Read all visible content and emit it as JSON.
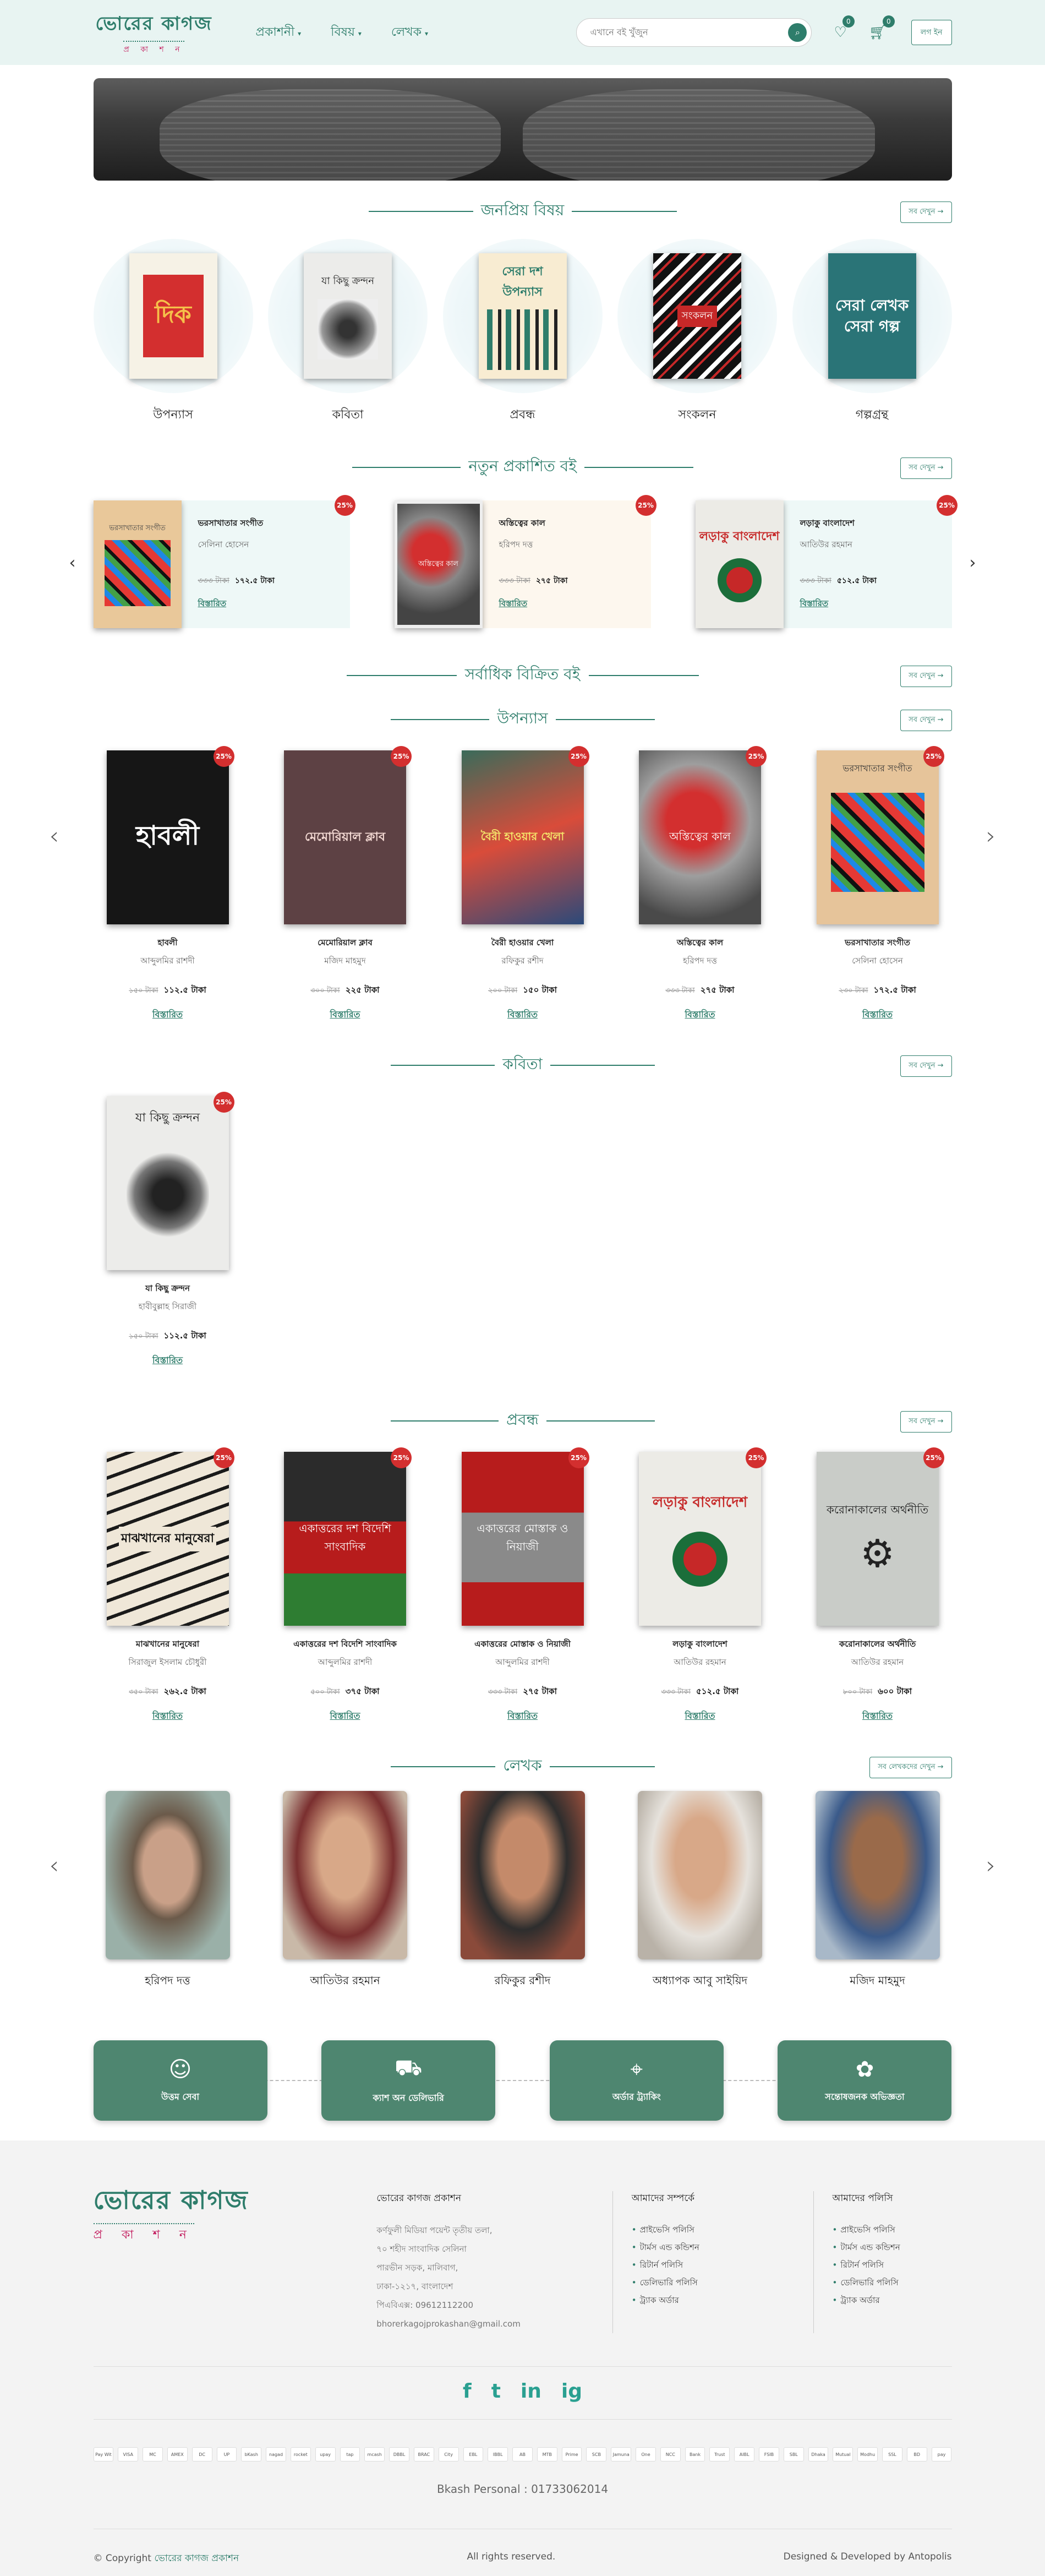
{
  "header": {
    "logo_top": "ভোরের কাগজ",
    "logo_bottom": "প্র কা শ ন",
    "nav": [
      "প্রকাশনী",
      "বিষয়",
      "লেখক"
    ],
    "search_placeholder": "এখানে বই খুঁজুন",
    "wishlist_count": "0",
    "cart_count": "0",
    "login_label": "লগ ইন"
  },
  "popular": {
    "title": "জনপ্রিয় বিষয়",
    "more": "সব দেখুন →",
    "items": [
      {
        "name": "উপন্যাস",
        "cover_text": "দিক"
      },
      {
        "name": "কবিতা",
        "cover_text": "যা কিছু ক্রন্দন"
      },
      {
        "name": "প্রবন্ধ",
        "cover_text": "সেরা দশ উপন্যাস"
      },
      {
        "name": "সংকলন",
        "cover_text": "সংকলন"
      },
      {
        "name": "গল্পগ্রন্থ",
        "cover_text": "সেরা লেখক সেরা গল্প"
      }
    ]
  },
  "new_releases": {
    "title": "নতুন প্রকাশিত বই",
    "more": "সব দেখুন →",
    "items": [
      {
        "title": "ভরসাখাতার সংগীত",
        "author": "সেলিনা হোসেন",
        "old": "৩৩৩ টাকা",
        "price": "১৭২.৫ টাকা",
        "discount": "25%",
        "cta": "বিস্তারিত"
      },
      {
        "title": "অস্তিত্বের কাল",
        "author": "হরিপদ দত্ত",
        "old": "৩৩৩ টাকা",
        "price": "২৭৫ টাকা",
        "discount": "25%",
        "cta": "বিস্তারিত"
      },
      {
        "title": "লড়াকু বাংলাদেশ",
        "author": "আতিউর রহমান",
        "old": "৩৩৩ টাকা",
        "price": "৫১২.৫ টাকা",
        "discount": "25%",
        "cta": "বিস্তারিত"
      }
    ]
  },
  "bestseller": {
    "title": "সর্বাধিক বিক্রিত বই",
    "more": "সব দেখুন →"
  },
  "novels": {
    "title": "উপন্যাস",
    "more": "সব দেখুন →",
    "items": [
      {
        "title": "হাবলী",
        "author": "আব্দুলমির রাশদী",
        "old": "১৫০ টাকা",
        "price": "১১২.৫ টাকা",
        "discount": "25%",
        "cta": "বিস্তারিত",
        "cover_text": "হাবলী"
      },
      {
        "title": "মেমোরিয়াল ক্লাব",
        "author": "মজিদ মাহমুদ",
        "old": "৩০০ টাকা",
        "price": "২২৫ টাকা",
        "discount": "25%",
        "cta": "বিস্তারিত",
        "cover_text": "মেমোরিয়াল ক্লাব"
      },
      {
        "title": "বৈরী হাওয়ার খেলা",
        "author": "রফিকুর রশীদ",
        "old": "২০০ টাকা",
        "price": "১৫০ টাকা",
        "discount": "25%",
        "cta": "বিস্তারিত",
        "cover_text": "বৈরী হাওয়ার খেলা"
      },
      {
        "title": "অস্তিত্বের কাল",
        "author": "হরিপদ দত্ত",
        "old": "৩৩৩ টাকা",
        "price": "২৭৫ টাকা",
        "discount": "25%",
        "cta": "বিস্তারিত",
        "cover_text": "অস্তিত্বের কাল"
      },
      {
        "title": "ভরসাখাতার সংগীত",
        "author": "সেলিনা হোসেন",
        "old": "২৩০ টাকা",
        "price": "১৭২.৫ টাকা",
        "discount": "25%",
        "cta": "বিস্তারিত",
        "cover_text": "ভরসাখাতার সংগীত"
      }
    ]
  },
  "poetry": {
    "title": "কবিতা",
    "more": "সব দেখুন →",
    "items": [
      {
        "title": "যা কিছু ক্রন্দন",
        "author": "হাবীবুল্লাহ সিরাজী",
        "old": "১৫০ টাকা",
        "price": "১১২.৫ টাকা",
        "discount": "25%",
        "cta": "বিস্তারিত",
        "cover_text": "যা কিছু ক্রন্দন"
      }
    ]
  },
  "essays": {
    "title": "প্রবন্ধ",
    "more": "সব দেখুন →",
    "items": [
      {
        "title": "মাঝখানের মানুষেরা",
        "author": "সিরাজুল ইসলাম চৌধুরী",
        "old": "৩৫০ টাকা",
        "price": "২৬২.৫ টাকা",
        "discount": "25%",
        "cta": "বিস্তারিত",
        "cover_text": "মাঝখানের মানুষেরা"
      },
      {
        "title": "একাত্তরের দশ বিদেশি সাংবাদিক",
        "author": "আব্দুলমির রাশদী",
        "old": "৫০০ টাকা",
        "price": "৩৭৫ টাকা",
        "discount": "25%",
        "cta": "বিস্তারিত",
        "cover_text": "একাত্তরের দশ বিদেশি সাংবাদিক"
      },
      {
        "title": "একাত্তরের মোস্তাক ও নিয়াজী",
        "author": "আব্দুলমির রাশদী",
        "old": "৩৩৩ টাকা",
        "price": "২৭৫ টাকা",
        "discount": "25%",
        "cta": "বিস্তারিত",
        "cover_text": "একাত্তরের মোস্তাক ও নিয়াজী"
      },
      {
        "title": "লড়াকু বাংলাদেশ",
        "author": "আতিউর রহমান",
        "old": "৩৩৩ টাকা",
        "price": "৫১২.৫ টাকা",
        "discount": "25%",
        "cta": "বিস্তারিত",
        "cover_text": "লড়াকু বাংলাদেশ"
      },
      {
        "title": "করোনাকালের অর্থনীতি",
        "author": "আতিউর রহমান",
        "old": "৮০০ টাকা",
        "price": "৬০০ টাকা",
        "discount": "25%",
        "cta": "বিস্তারিত",
        "cover_text": "করোনাকালের অর্থনীতি"
      }
    ]
  },
  "authors": {
    "title": "লেখক",
    "more": "সব লেখকদের দেখুন →",
    "items": [
      "হরিপদ দত্ত",
      "আতিউর রহমান",
      "রফিকুর রশীদ",
      "অধ্যাপক আবু সাইয়িদ",
      "মজিদ মাহমুদ"
    ]
  },
  "features": [
    "উত্তম সেবা",
    "ক্যাশ অন ডেলিভারি",
    "অর্ডার ট্র্যাকিং",
    "সন্তোষজনক অভিজ্ঞতা"
  ],
  "footer": {
    "logo_top": "ভোরের কাগজ",
    "logo_bottom": "প্র কা শ ন",
    "contact_title": "ভোরের কাগজ প্রকাশন",
    "contact_lines": [
      "কর্ণফুলী মিডিয়া পয়েন্ট তৃতীয় তলা,",
      "৭০ শহীদ সাংবাদিক সেলিনা",
      "পারভীন সড়ক, মালিবাগ,",
      "ঢাকা-১২১৭, বাংলাদেশ",
      "পিএবিএক্স: 09612112200",
      "bhorerkagojprokashan@gmail.com"
    ],
    "about_title": "আমাদের সম্পর্কে",
    "about_links": [
      "প্রাইভেসি পলিসি",
      "টার্মস এন্ড কন্ডিশন",
      "রিটার্ন পলিসি",
      "ডেলিভারি পলিসি",
      "ট্র্যাক অর্ডার"
    ],
    "policy_title": "আমাদের পলিসি",
    "policy_links": [
      "প্রাইভেসি পলিসি",
      "টার্মস এন্ড কন্ডিশন",
      "রিটার্ন পলিসি",
      "ডেলিভারি পলিসি",
      "ট্র্যাক অর্ডার"
    ],
    "social": [
      "f",
      "t",
      "in",
      "ig"
    ],
    "payments": [
      "Pay Wit",
      "VISA",
      "MC",
      "AMEX",
      "DC",
      "UP",
      "bKash",
      "nagad",
      "rocket",
      "upay",
      "tap",
      "mcash",
      "DBBL",
      "BRAC",
      "City",
      "EBL",
      "IBBL",
      "AB",
      "MTB",
      "Prime",
      "SCB",
      "Jamuna",
      "One",
      "NCC",
      "Bank",
      "Trust",
      "AIBL",
      "FSIB",
      "SBL",
      "Dhaka",
      "Mutual",
      "Modhu",
      "SSL",
      "BD",
      "pay"
    ],
    "bkash": "Bkash Personal : 01733062014",
    "copyright_pre": "© Copyright",
    "copyright_brand": "ভোরের কাগজ প্রকাশন",
    "rights": "All rights reserved.",
    "developer": "Designed & Developed by Antopolis"
  },
  "colors": {
    "brand": "#2e7d6b",
    "discount": "#d32f2f",
    "feature_bg": "#4e8670"
  }
}
